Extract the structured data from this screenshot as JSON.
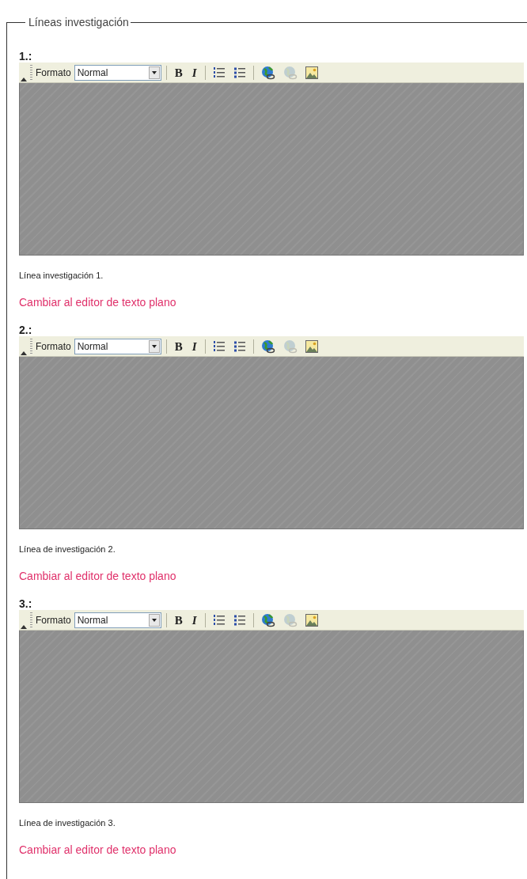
{
  "fieldset": {
    "legend": "Líneas investigación"
  },
  "editors": [
    {
      "label": "1.:",
      "toolbar": {
        "format_label": "Formato",
        "format_value": "Normal",
        "buttons": [
          {
            "kind": "bold",
            "text": "B",
            "disabled": false
          },
          {
            "kind": "italic",
            "text": "I",
            "disabled": false
          },
          {
            "kind": "separator"
          },
          {
            "kind": "numbered-list",
            "disabled": false
          },
          {
            "kind": "bullet-list",
            "disabled": false
          },
          {
            "kind": "separator"
          },
          {
            "kind": "link",
            "disabled": false
          },
          {
            "kind": "unlink",
            "disabled": true
          },
          {
            "kind": "image",
            "disabled": false
          }
        ]
      },
      "caption": "Línea investigación 1.",
      "switch_link": "Cambiar al editor de texto plano"
    },
    {
      "label": "2.:",
      "toolbar": {
        "format_label": "Formato",
        "format_value": "Normal",
        "buttons": [
          {
            "kind": "bold",
            "text": "B",
            "disabled": false
          },
          {
            "kind": "italic",
            "text": "I",
            "disabled": false
          },
          {
            "kind": "separator"
          },
          {
            "kind": "numbered-list",
            "disabled": false
          },
          {
            "kind": "bullet-list",
            "disabled": false
          },
          {
            "kind": "separator"
          },
          {
            "kind": "link",
            "disabled": false
          },
          {
            "kind": "unlink",
            "disabled": true
          },
          {
            "kind": "image",
            "disabled": false
          }
        ]
      },
      "caption": "Línea de investigación 2.",
      "switch_link": "Cambiar al editor de texto plano"
    },
    {
      "label": "3.:",
      "toolbar": {
        "format_label": "Formato",
        "format_value": "Normal",
        "buttons": [
          {
            "kind": "bold",
            "text": "B",
            "disabled": false
          },
          {
            "kind": "italic",
            "text": "I",
            "disabled": false
          },
          {
            "kind": "separator"
          },
          {
            "kind": "numbered-list",
            "disabled": false
          },
          {
            "kind": "bullet-list",
            "disabled": false
          },
          {
            "kind": "separator"
          },
          {
            "kind": "link",
            "disabled": false
          },
          {
            "kind": "unlink",
            "disabled": true
          },
          {
            "kind": "image",
            "disabled": false
          }
        ]
      },
      "caption": "Línea de investigación 3.",
      "switch_link": "Cambiar al editor de texto plano"
    }
  ]
}
